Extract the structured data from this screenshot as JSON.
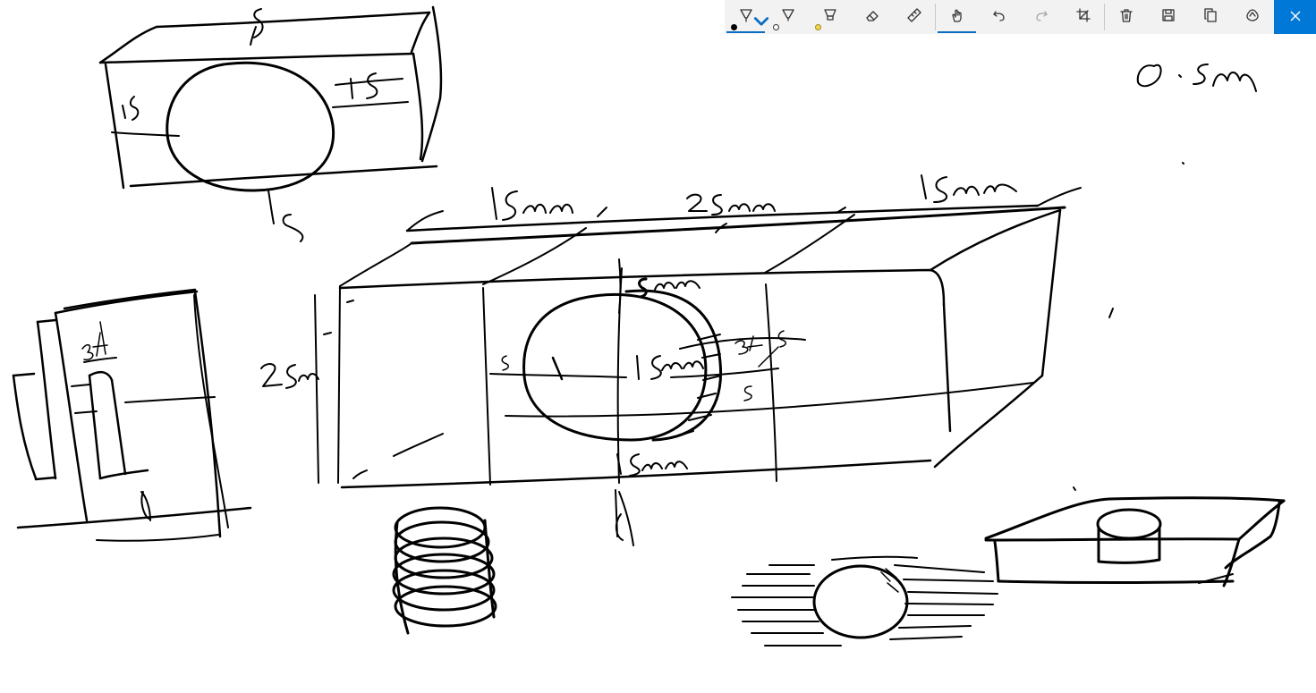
{
  "app": {
    "type": "ink sketch canvas",
    "background_color": "#ffffff",
    "ink_color": "#000000"
  },
  "toolbar": {
    "background_color": "#f2f2f2",
    "accent_color": "#0078d7",
    "active_underline_color": "#0a6fc2",
    "tools": [
      {
        "name": "ballpoint-pen",
        "icon": "ballpoint-pen-icon",
        "dot_color": "#000000",
        "selected": true,
        "has_dropdown": true
      },
      {
        "name": "pencil",
        "icon": "pencil-icon",
        "dot_color": "#ffffff"
      },
      {
        "name": "highlighter",
        "icon": "highlighter-icon",
        "dot_color": "#f4d84a"
      },
      {
        "name": "eraser",
        "icon": "eraser-icon"
      },
      {
        "name": "ruler",
        "icon": "ruler-icon"
      },
      {
        "name": "touch-writing",
        "icon": "touch-writing-icon",
        "active": true
      },
      {
        "name": "undo",
        "icon": "undo-icon"
      },
      {
        "name": "redo",
        "icon": "redo-icon",
        "disabled": true
      },
      {
        "name": "crop",
        "icon": "crop-icon"
      },
      {
        "name": "delete",
        "icon": "trash-icon"
      },
      {
        "name": "save",
        "icon": "save-icon"
      },
      {
        "name": "copy",
        "icon": "copy-icon"
      },
      {
        "name": "share",
        "icon": "share-icon"
      },
      {
        "name": "close",
        "icon": "close-icon"
      }
    ]
  },
  "sketch": {
    "handwritten_annotations": [
      "5",
      "15",
      "15",
      "5",
      "15mm",
      "25mm",
      "15mm",
      "25mm",
      "5mm",
      "15mm",
      "34",
      "5",
      "5",
      "5",
      "1",
      "15mm",
      "34",
      "0.5m"
    ]
  }
}
